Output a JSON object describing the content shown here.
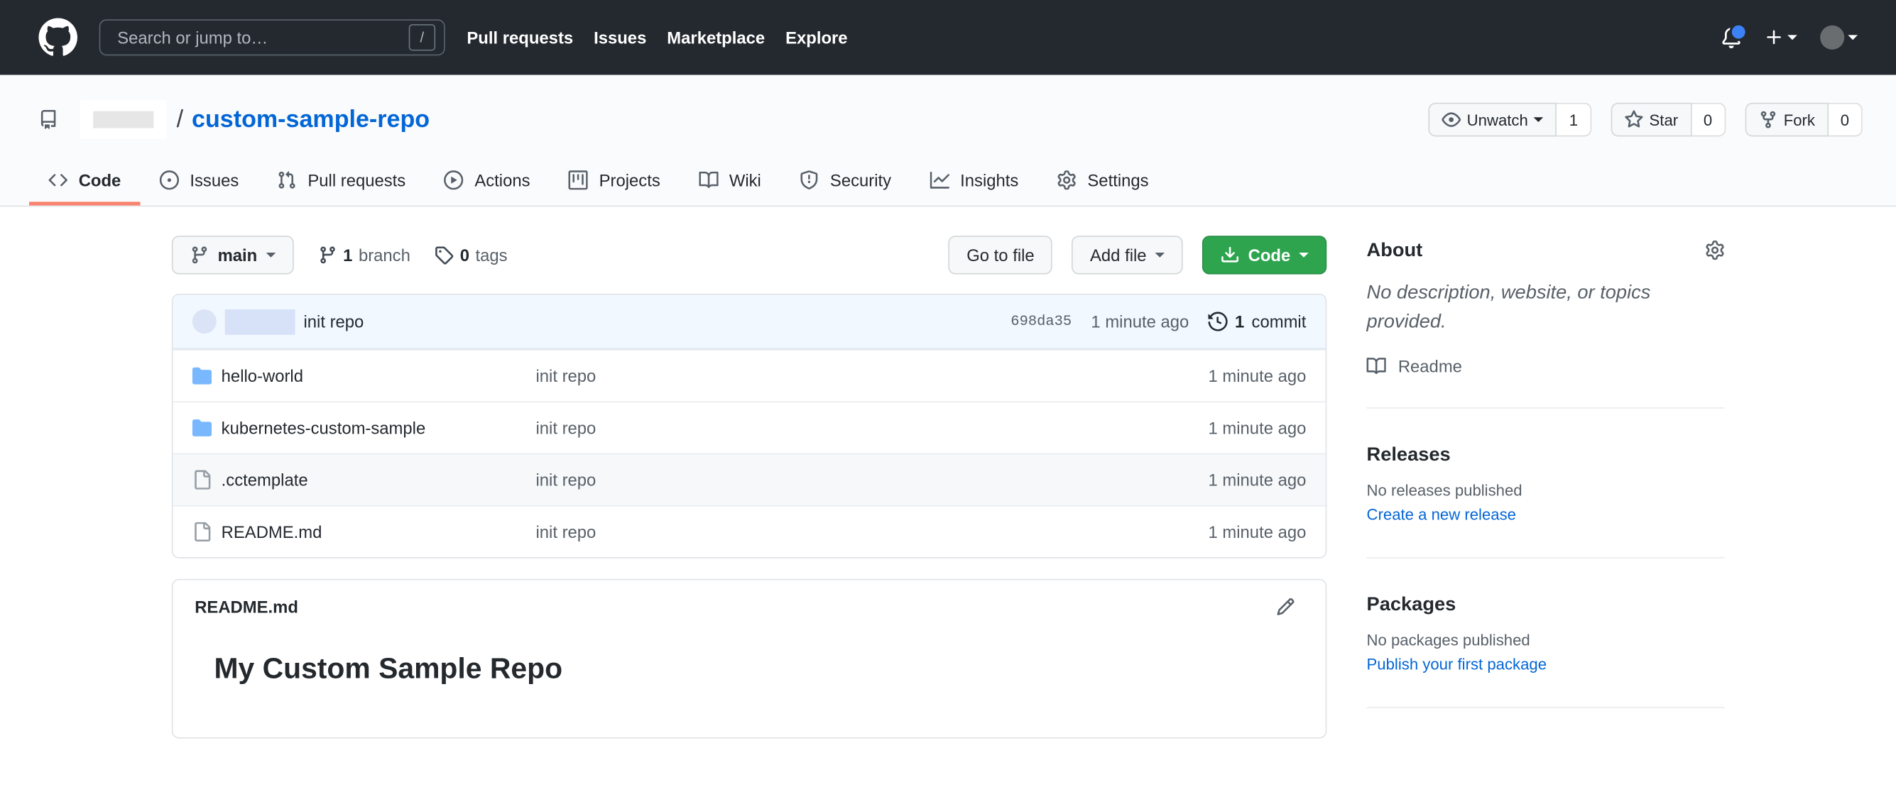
{
  "header": {
    "search_placeholder": "Search or jump to…",
    "search_key_hint": "/",
    "nav": [
      {
        "label": "Pull requests"
      },
      {
        "label": "Issues"
      },
      {
        "label": "Marketplace"
      },
      {
        "label": "Explore"
      }
    ]
  },
  "repo": {
    "separator": "/",
    "name": "custom-sample-repo",
    "actions": {
      "unwatch_label": "Unwatch",
      "unwatch_count": "1",
      "star_label": "Star",
      "star_count": "0",
      "fork_label": "Fork",
      "fork_count": "0"
    },
    "tabs": [
      {
        "label": "Code"
      },
      {
        "label": "Issues"
      },
      {
        "label": "Pull requests"
      },
      {
        "label": "Actions"
      },
      {
        "label": "Projects"
      },
      {
        "label": "Wiki"
      },
      {
        "label": "Security"
      },
      {
        "label": "Insights"
      },
      {
        "label": "Settings"
      }
    ]
  },
  "toolbar": {
    "branch_button_label": "main",
    "branches_count": "1",
    "branches_label": "branch",
    "tags_count": "0",
    "tags_label": "tags",
    "goto_file_label": "Go to file",
    "add_file_label": "Add file",
    "code_button_label": "Code"
  },
  "commit_bar": {
    "message": "init repo",
    "sha": "698da35",
    "time": "1 minute ago",
    "commits_count": "1",
    "commits_label": "commit"
  },
  "files": [
    {
      "name": "hello-world",
      "type": "folder",
      "message": "init repo",
      "time": "1 minute ago"
    },
    {
      "name": "kubernetes-custom-sample",
      "type": "folder",
      "message": "init repo",
      "time": "1 minute ago"
    },
    {
      "name": ".cctemplate",
      "type": "file",
      "message": "init repo",
      "time": "1 minute ago"
    },
    {
      "name": "README.md",
      "type": "file",
      "message": "init repo",
      "time": "1 minute ago"
    }
  ],
  "readme": {
    "filename": "README.md",
    "heading": "My Custom Sample Repo"
  },
  "sidebar": {
    "about": {
      "title": "About",
      "description": "No description, website, or topics provided.",
      "readme_label": "Readme"
    },
    "releases": {
      "title": "Releases",
      "empty": "No releases published",
      "link": "Create a new release"
    },
    "packages": {
      "title": "Packages",
      "empty": "No packages published",
      "link": "Publish your first package"
    }
  },
  "colors": {
    "header_bg": "#24292f",
    "link_blue": "#0366d6",
    "tab_underline": "#f9826c",
    "code_button_green": "#2ea44f",
    "commit_bar_bg": "#f1f8ff",
    "folder_icon_blue": "#79b8ff",
    "notification_dot_blue": "#3b82f6"
  }
}
